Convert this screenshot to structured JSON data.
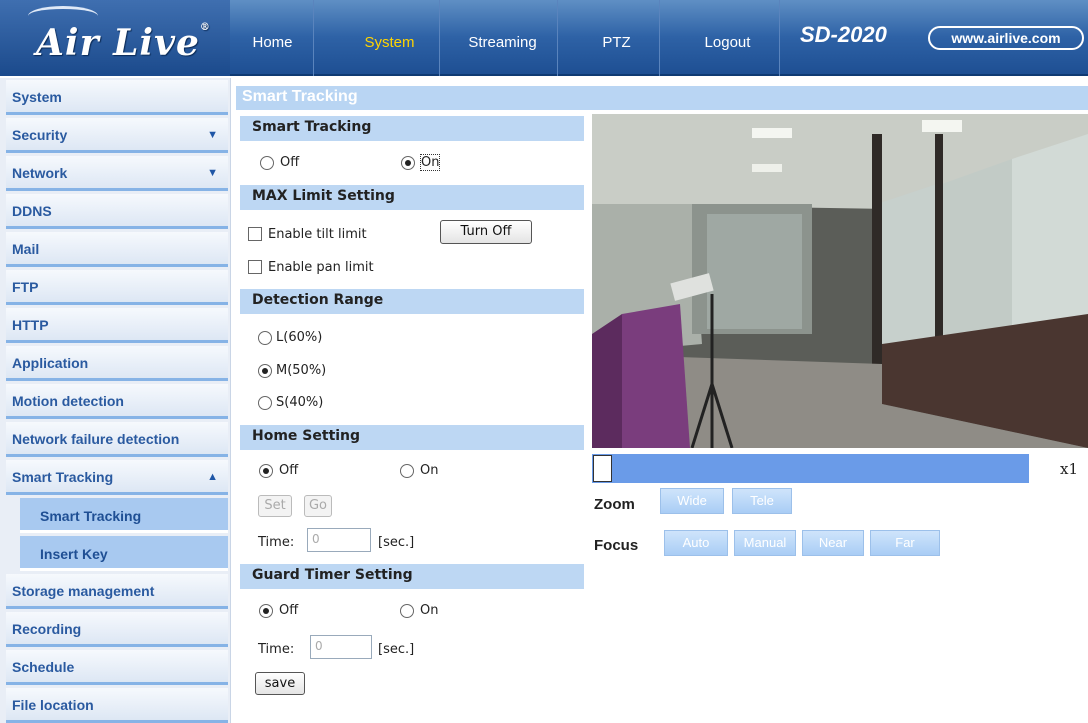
{
  "header": {
    "logo_text": "Air Live",
    "model": "SD-2020",
    "site": "www.airlive.com",
    "nav": [
      {
        "label": "Home",
        "active": false
      },
      {
        "label": "System",
        "active": true
      },
      {
        "label": "Streaming",
        "active": false
      },
      {
        "label": "PTZ",
        "active": false
      },
      {
        "label": "Logout",
        "active": false
      }
    ]
  },
  "sidebar": {
    "items": [
      {
        "label": "System"
      },
      {
        "label": "Security",
        "arrow": "▼"
      },
      {
        "label": "Network",
        "arrow": "▼"
      },
      {
        "label": "DDNS"
      },
      {
        "label": "Mail"
      },
      {
        "label": "FTP"
      },
      {
        "label": "HTTP"
      },
      {
        "label": "Application"
      },
      {
        "label": "Motion detection"
      },
      {
        "label": "Network failure detection"
      },
      {
        "label": "Smart Tracking",
        "arrow": "▲"
      },
      {
        "label": "Smart Tracking",
        "sub": true
      },
      {
        "label": "Insert Key",
        "sub": true
      },
      {
        "label": "Storage management"
      },
      {
        "label": "Recording"
      },
      {
        "label": "Schedule"
      },
      {
        "label": "File location"
      }
    ]
  },
  "page": {
    "title": "Smart Tracking",
    "smart_tracking": {
      "header": "Smart Tracking",
      "off_label": "Off",
      "on_label": "On",
      "selected": "on"
    },
    "max_limit": {
      "header": "MAX Limit Setting",
      "tilt_label": "Enable tilt limit",
      "pan_label": "Enable pan limit",
      "turn_off_label": "Turn Off"
    },
    "detection_range": {
      "header": "Detection Range",
      "options": [
        "L(60%)",
        "M(50%)",
        "S(40%)"
      ],
      "selected": "M(50%)"
    },
    "home_setting": {
      "header": "Home Setting",
      "off_label": "Off",
      "on_label": "On",
      "selected": "off",
      "set_label": "Set",
      "go_label": "Go",
      "time_label": "Time:",
      "time_value": "0",
      "unit": "[sec.]"
    },
    "guard_timer": {
      "header": "Guard Timer Setting",
      "off_label": "Off",
      "on_label": "On",
      "selected": "off",
      "time_label": "Time:",
      "time_value": "0",
      "unit": "[sec.]"
    },
    "save_label": "save"
  },
  "ptz": {
    "zoom_level": "x1",
    "zoom_label": "Zoom",
    "wide_label": "Wide",
    "tele_label": "Tele",
    "focus_label": "Focus",
    "auto_label": "Auto",
    "manual_label": "Manual",
    "near_label": "Near",
    "far_label": "Far"
  }
}
